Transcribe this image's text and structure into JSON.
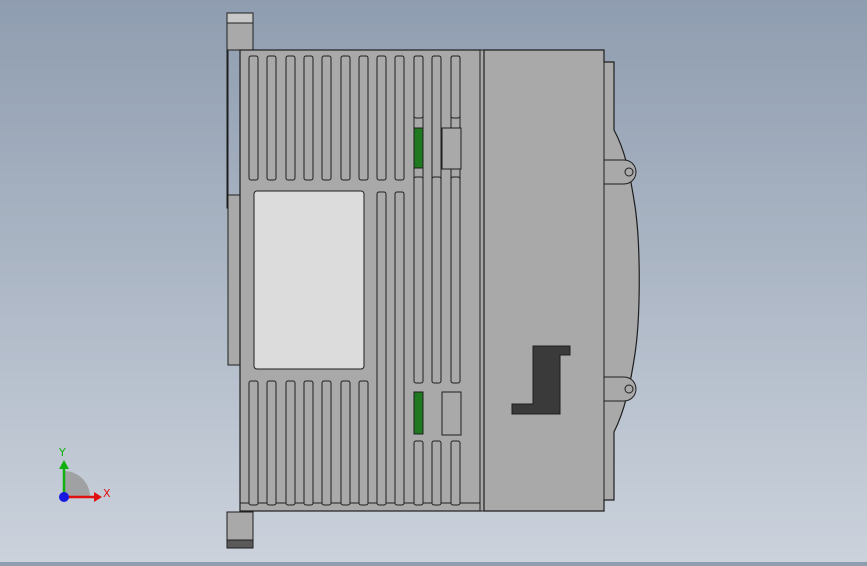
{
  "view": {
    "background_top": "#8f9db0",
    "background_bottom": "#cbd2dc",
    "body_color": "#a9a9a9",
    "edge_color": "#1e1e1e",
    "window_color": "#dcdcdc",
    "led_color": "#1f7a1f",
    "latch_color": "#3a3a3a"
  },
  "triad": {
    "x_label": "X",
    "y_label": "Y",
    "x_color": "#e01010",
    "y_color": "#10b010",
    "z_color": "#1818e0"
  }
}
